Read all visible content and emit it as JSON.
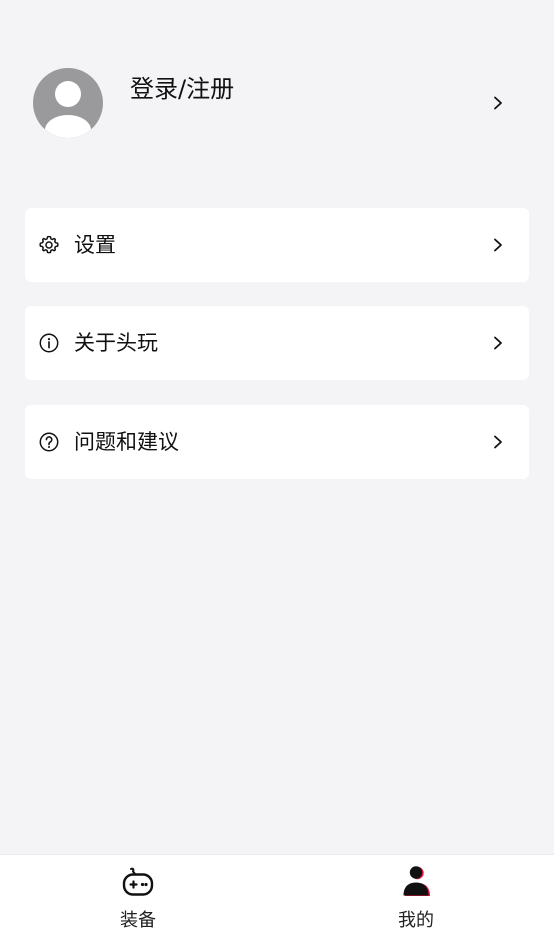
{
  "profile": {
    "login_label": "登录/注册"
  },
  "menu": {
    "items": [
      {
        "label": "设置",
        "icon": "gear-icon"
      },
      {
        "label": "关于头玩",
        "icon": "info-icon"
      },
      {
        "label": "问题和建议",
        "icon": "question-icon"
      }
    ]
  },
  "tabbar": {
    "tabs": [
      {
        "label": "装备",
        "icon": "gamepad-icon",
        "active": false
      },
      {
        "label": "我的",
        "icon": "person-icon",
        "active": true
      }
    ]
  },
  "colors": {
    "background": "#f4f4f6",
    "card": "#ffffff",
    "avatar": "#9a9a9c",
    "accent": "#e8173f"
  }
}
